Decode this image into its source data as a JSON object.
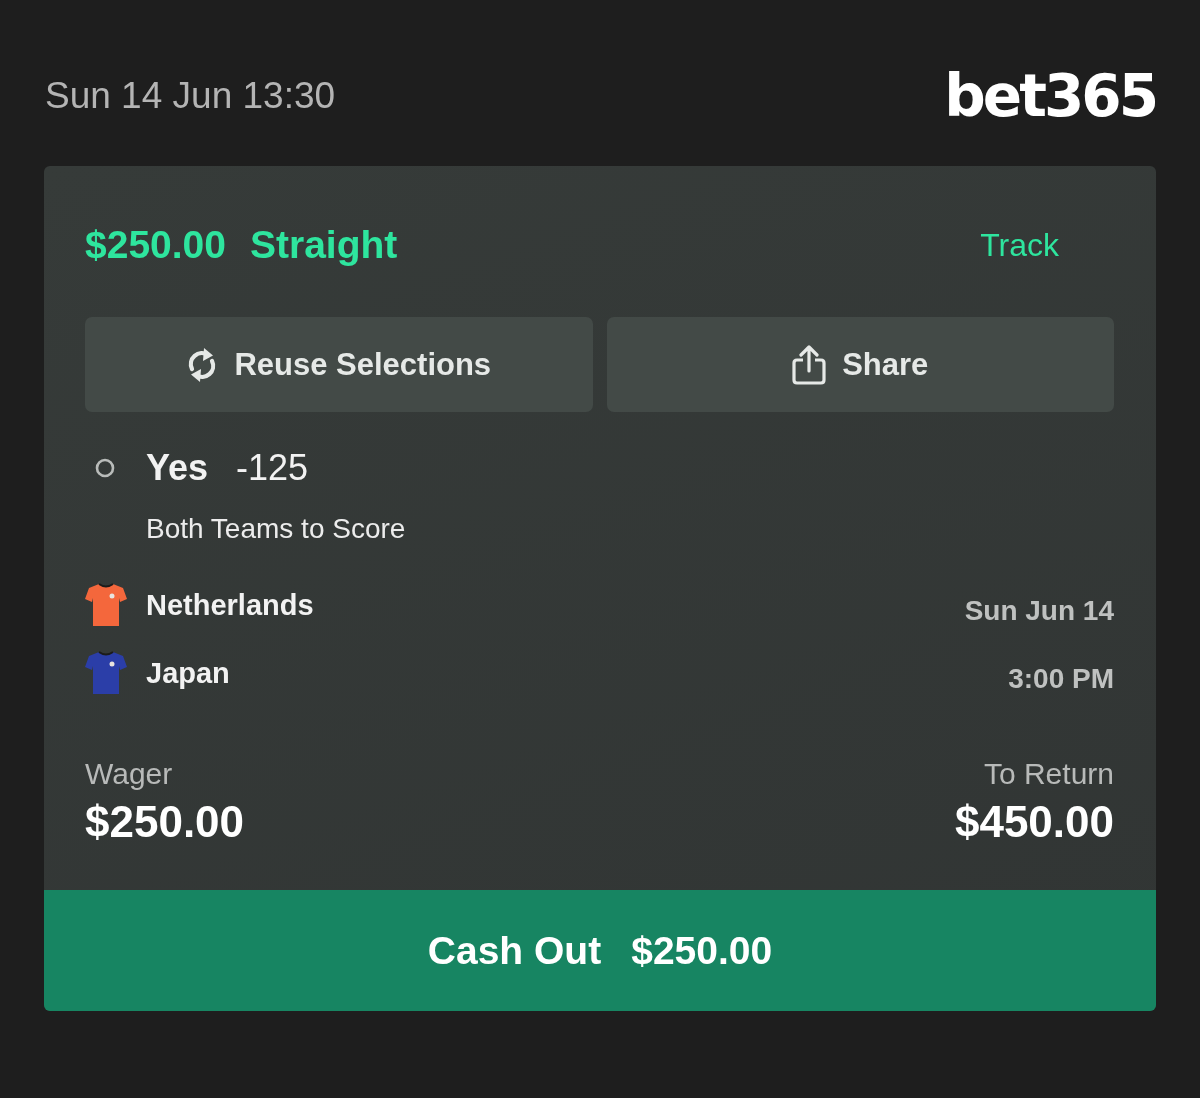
{
  "header": {
    "datetime": "Sun 14 Jun 13:30",
    "logo": "bet365"
  },
  "bet": {
    "stake": "$250.00",
    "type": "Straight",
    "track": "Track"
  },
  "actions": [
    {
      "kind": "reuse",
      "label": "Reuse Selections"
    },
    {
      "kind": "share",
      "label": "Share"
    }
  ],
  "selection": {
    "name": "Yes",
    "odds": "-125",
    "market": "Both Teams to Score"
  },
  "fixture": {
    "teams": [
      {
        "name": "Netherlands",
        "color": "#f4673c"
      },
      {
        "name": "Japan",
        "color": "#2b3ea8"
      }
    ],
    "date": "Sun Jun 14",
    "time": "3:00 PM"
  },
  "totals": [
    {
      "label": "Wager",
      "value": "$250.00"
    },
    {
      "label": "To Return",
      "value": "$450.00"
    }
  ],
  "cash_out": {
    "label": "Cash Out",
    "amount": "$250.00"
  }
}
